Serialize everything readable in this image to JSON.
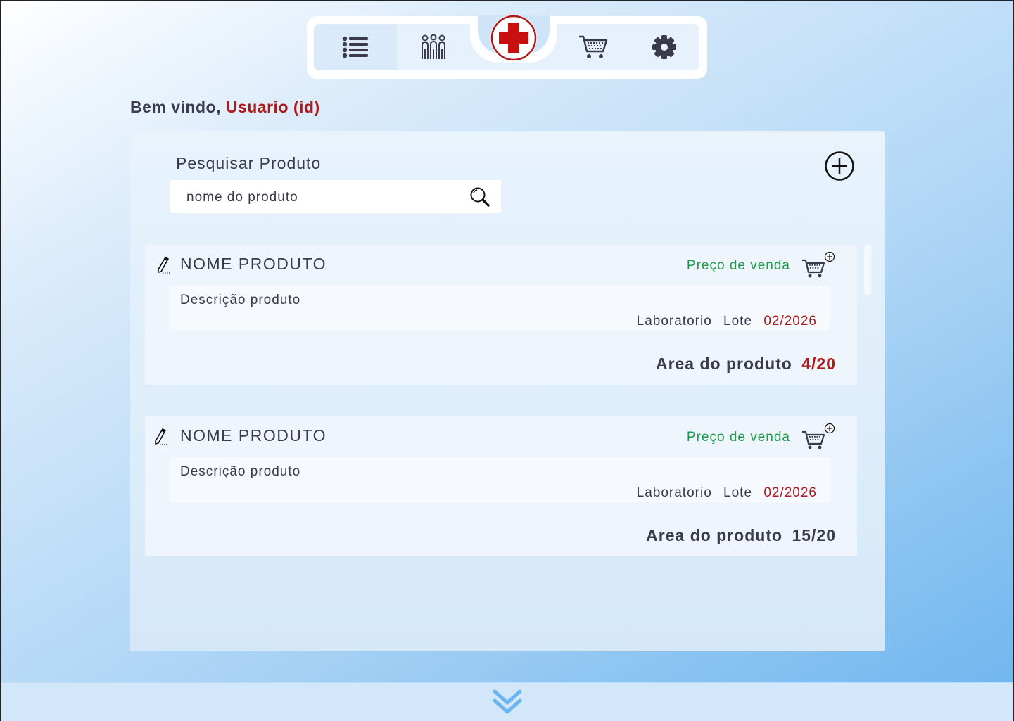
{
  "nav": {
    "items": [
      {
        "icon": "list-icon"
      },
      {
        "icon": "users-icon"
      },
      {
        "icon": "red-cross-icon"
      },
      {
        "icon": "cart-icon"
      },
      {
        "icon": "gear-icon"
      }
    ]
  },
  "welcome": {
    "prefix": "Bem vindo,",
    "user": "Usuario (id)"
  },
  "search": {
    "label": "Pesquisar Produto",
    "placeholder": "nome do produto",
    "value": ""
  },
  "products": [
    {
      "name": "NOME PRODUTO",
      "price_label": "Preço de venda",
      "description": "Descrição produto",
      "laboratorio": "Laboratorio",
      "lote_label": "Lote",
      "lote_date": "02/2026",
      "area_label": "Area do produto",
      "area_count": "4/20"
    },
    {
      "name": "NOME PRODUTO",
      "price_label": "Preço de venda",
      "description": "Descrição produto",
      "laboratorio": "Laboratorio",
      "lote_label": "Lote",
      "lote_date": "02/2026",
      "area_label": "Area do produto",
      "area_count": "15/20"
    }
  ],
  "colors": {
    "accent_red": "#b01818",
    "price_green": "#1e9a4a",
    "text_dark": "#3a3a4a"
  }
}
